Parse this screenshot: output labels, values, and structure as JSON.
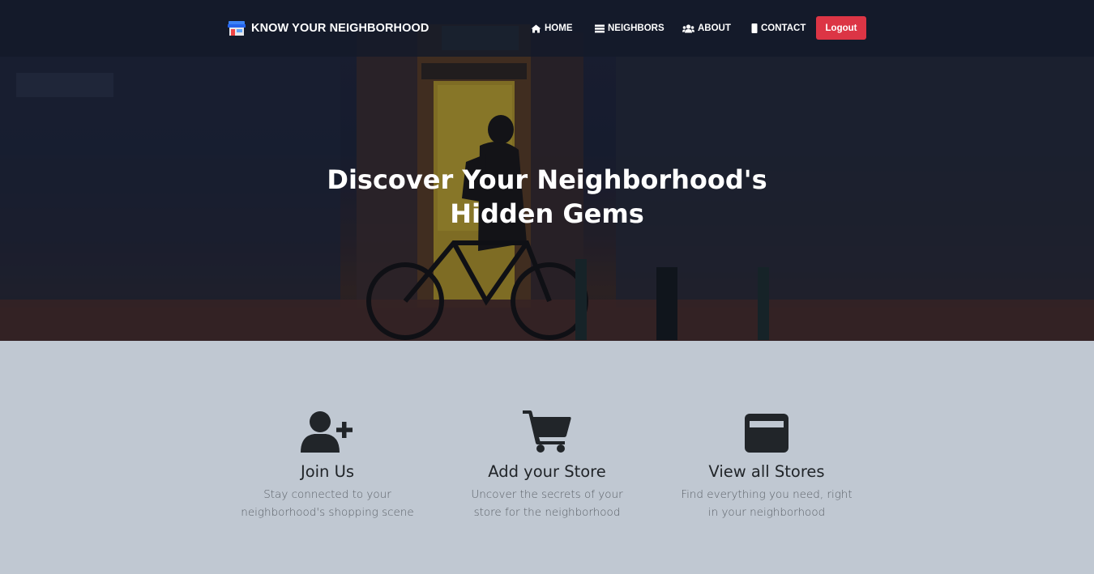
{
  "navbar": {
    "brand": "KNOW YOUR NEIGHBORHOOD",
    "links": [
      {
        "label": "HOME",
        "icon": "home-icon"
      },
      {
        "label": "NEIGHBORS",
        "icon": "list-icon"
      },
      {
        "label": "ABOUT",
        "icon": "users-icon"
      },
      {
        "label": "CONTACT",
        "icon": "mobile-icon"
      }
    ],
    "logout_label": "Logout"
  },
  "hero": {
    "title": "Discover Your Neighborhood's Hidden Gems"
  },
  "features": [
    {
      "icon": "user-plus-icon",
      "title": "Join Us",
      "text": "Stay connected to your neighborhood's shopping scene"
    },
    {
      "icon": "shopping-cart-icon",
      "title": "Add your Store",
      "text": "Uncover the secrets of your store for the neighborhood"
    },
    {
      "icon": "credit-card-icon",
      "title": "View all Stores",
      "text": "Find everything you need, right in your neighborhood"
    }
  ],
  "colors": {
    "logout_button": "#dc3545",
    "features_background": "#c0c8d2",
    "heading_text": "#212529",
    "body_text": "#5b6168"
  }
}
